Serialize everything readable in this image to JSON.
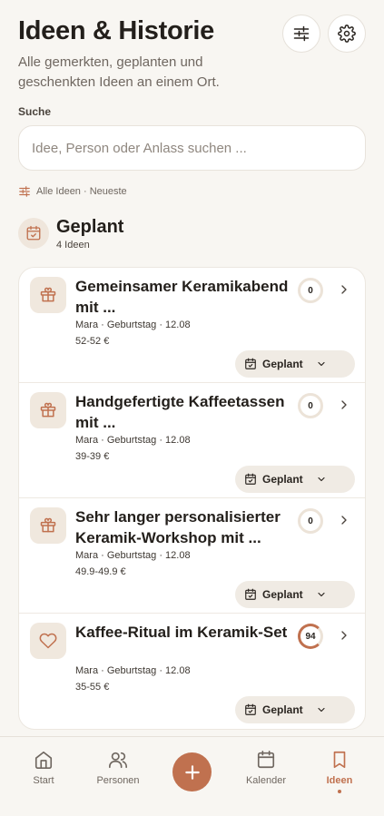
{
  "header": {
    "title": "Ideen & Historie",
    "subtitle": "Alle gemerkten, geplanten und geschenkten Ideen an einem Ort."
  },
  "icons": {
    "filter": "sliders-icon",
    "settings": "gear-icon"
  },
  "search": {
    "label": "Suche",
    "value": "",
    "placeholder": "Idee, Person oder Anlass suchen ..."
  },
  "filter_summary": "Alle Ideen · Neueste",
  "section": {
    "title": "Geplant",
    "count": "4 Ideen"
  },
  "ideas": [
    {
      "title": "Gemeinsamer Keramikabend mit ...",
      "meta": "Mara · Geburtstag · 12.08",
      "price": "52-52 €",
      "score": "0",
      "icon": "gift-icon",
      "status": "Geplant"
    },
    {
      "title": "Handgefertigte Kaffeetassen mit ...",
      "meta": "Mara · Geburtstag · 12.08",
      "price": "39-39 €",
      "score": "0",
      "icon": "gift-icon",
      "status": "Geplant"
    },
    {
      "title": "Sehr langer personalisierter Keramik-Workshop mit ...",
      "meta": "Mara · Geburtstag · 12.08",
      "price": "49.9-49.9 €",
      "score": "0",
      "icon": "gift-icon",
      "status": "Geplant"
    },
    {
      "title": "Kaffee-Ritual im Keramik-Set",
      "meta": "Mara · Geburtstag · 12.08",
      "price": "35-55 €",
      "score": "94",
      "icon": "heart-icon",
      "status": "Geplant"
    }
  ],
  "nav": {
    "start": "Start",
    "persons": "Personen",
    "calendar": "Kalender",
    "ideas": "Ideen",
    "active": "ideas"
  },
  "colors": {
    "accent": "#c0714f",
    "background": "#f8f6f2"
  }
}
